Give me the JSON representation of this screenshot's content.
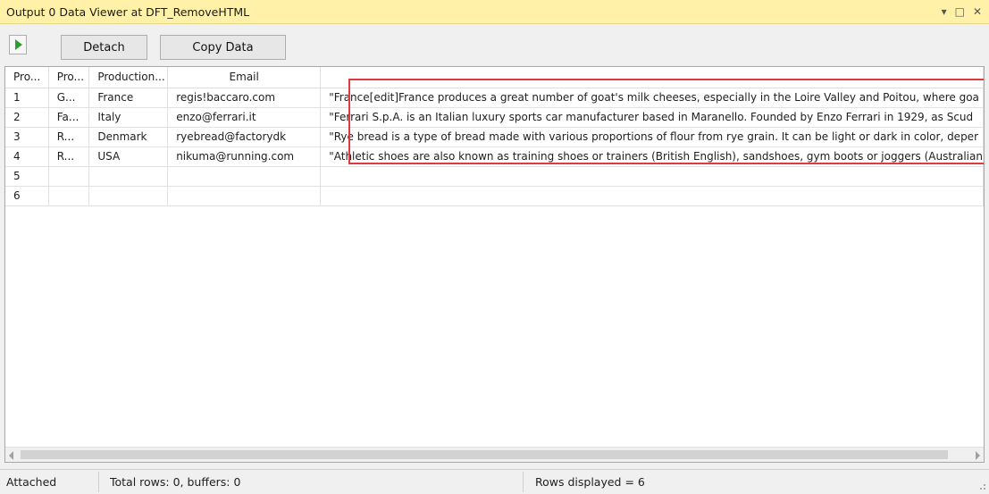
{
  "window": {
    "title": "Output 0 Data Viewer at DFT_RemoveHTML",
    "controls": [
      "▾",
      "□",
      "✕"
    ]
  },
  "toolbar": {
    "play_icon": "play-icon",
    "detach_label": "Detach",
    "copy_label": "Copy Data"
  },
  "grid": {
    "headers": [
      "Pro...",
      "Pro...",
      "Production...",
      "Email",
      ""
    ],
    "rows": [
      [
        "1",
        "G...",
        "France",
        "regis!baccaro.com",
        "\"France[edit]France produces a great number of goat's milk cheeses, especially in the Loire Valley and Poitou, where goa"
      ],
      [
        "2",
        "Fa...",
        "Italy",
        "enzo@ferrari.it",
        "\"Ferrari S.p.A. is an Italian luxury sports car manufacturer based in Maranello. Founded by Enzo Ferrari in 1929, as Scud"
      ],
      [
        "3",
        "R...",
        "Denmark",
        "ryebread@factorydk",
        "\"Rye bread is a type of bread made with various proportions of flour from rye grain. It can be light or dark in color, deper"
      ],
      [
        "4",
        "R...",
        "USA",
        "nikuma@running.com",
        "\"Athletic shoes are also known as training shoes or trainers (British English), sandshoes, gym boots or joggers (Australian"
      ],
      [
        "5",
        "",
        "",
        "",
        ""
      ],
      [
        "6",
        "",
        "",
        "",
        ""
      ]
    ],
    "highlight_color": "#e0393e"
  },
  "status": {
    "attached": "Attached",
    "total": "Total rows: 0, buffers: 0",
    "displayed": "Rows displayed = 6"
  }
}
